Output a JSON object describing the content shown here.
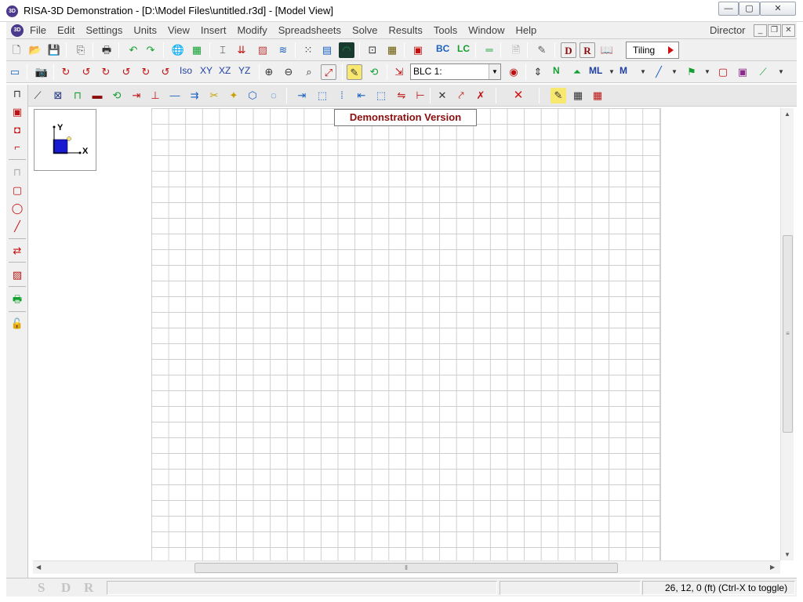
{
  "window": {
    "title": "RISA-3D Demonstration - [D:\\Model Files\\untitled.r3d] - [Model View]",
    "app_icon_text": "3D",
    "minimize_symbol": "—",
    "maximize_symbol": "▢",
    "close_symbol": "✕"
  },
  "menubar": {
    "items": [
      "File",
      "Edit",
      "Settings",
      "Units",
      "View",
      "Insert",
      "Modify",
      "Spreadsheets",
      "Solve",
      "Results",
      "Tools",
      "Window",
      "Help"
    ],
    "director": "Director",
    "mdi_minimize": "_",
    "mdi_restore": "❐",
    "mdi_close": "✕"
  },
  "toolbar1": {
    "bc_label": "BC",
    "lc_label": "LC",
    "tiling_label": "Tiling",
    "d_label": "D",
    "r_label": "R"
  },
  "toolbar2": {
    "iso_label": "Iso",
    "xy_label": "XY",
    "xz_label": "XZ",
    "yz_label": "YZ",
    "blc_value": "BLC 1:",
    "n_label": "N",
    "ml_label": "ML",
    "m_label": "M"
  },
  "canvas": {
    "demo_label": "Demonstration Version",
    "axis_y": "Y",
    "axis_x": "X",
    "grid_color": "#cfcfcf"
  },
  "statusbar": {
    "s": "S",
    "d": "D",
    "r": "R",
    "coords": "26, 12, 0 (ft)   (Ctrl-X to toggle)"
  },
  "colors": {
    "accent_red": "#d01010",
    "demo_red": "#8b0d0d",
    "toolbar_bg": "#f0f0f0",
    "icon_blue": "#204080",
    "icon_green": "#13a032"
  }
}
